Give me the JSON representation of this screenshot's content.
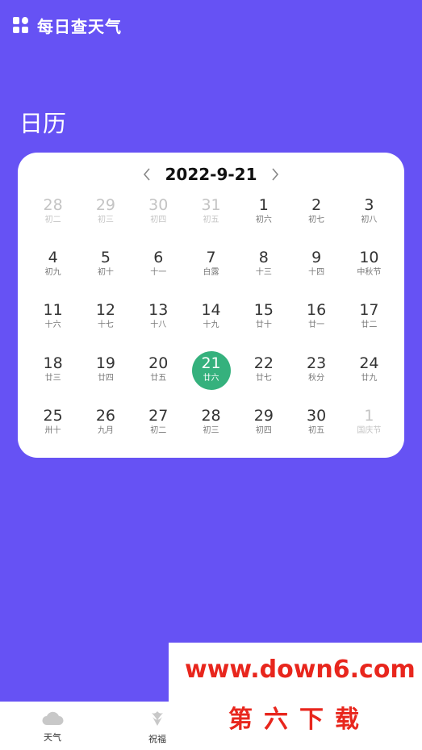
{
  "header": {
    "title": "每日查天气"
  },
  "page_title": "日历",
  "calendar": {
    "current_date": "2022-9-21",
    "days": [
      {
        "num": "28",
        "lunar": "初二",
        "muted": true
      },
      {
        "num": "29",
        "lunar": "初三",
        "muted": true
      },
      {
        "num": "30",
        "lunar": "初四",
        "muted": true
      },
      {
        "num": "31",
        "lunar": "初五",
        "muted": true
      },
      {
        "num": "1",
        "lunar": "初六"
      },
      {
        "num": "2",
        "lunar": "初七"
      },
      {
        "num": "3",
        "lunar": "初八"
      },
      {
        "num": "4",
        "lunar": "初九"
      },
      {
        "num": "5",
        "lunar": "初十"
      },
      {
        "num": "6",
        "lunar": "十一"
      },
      {
        "num": "7",
        "lunar": "白露"
      },
      {
        "num": "8",
        "lunar": "十三"
      },
      {
        "num": "9",
        "lunar": "十四"
      },
      {
        "num": "10",
        "lunar": "中秋节"
      },
      {
        "num": "11",
        "lunar": "十六"
      },
      {
        "num": "12",
        "lunar": "十七"
      },
      {
        "num": "13",
        "lunar": "十八"
      },
      {
        "num": "14",
        "lunar": "十九"
      },
      {
        "num": "15",
        "lunar": "廿十"
      },
      {
        "num": "16",
        "lunar": "廿一"
      },
      {
        "num": "17",
        "lunar": "廿二"
      },
      {
        "num": "18",
        "lunar": "廿三"
      },
      {
        "num": "19",
        "lunar": "廿四"
      },
      {
        "num": "20",
        "lunar": "廿五"
      },
      {
        "num": "21",
        "lunar": "廿六",
        "selected": true
      },
      {
        "num": "22",
        "lunar": "廿七"
      },
      {
        "num": "23",
        "lunar": "秋分"
      },
      {
        "num": "24",
        "lunar": "廿九"
      },
      {
        "num": "25",
        "lunar": "卅十"
      },
      {
        "num": "26",
        "lunar": "九月"
      },
      {
        "num": "27",
        "lunar": "初二"
      },
      {
        "num": "28",
        "lunar": "初三"
      },
      {
        "num": "29",
        "lunar": "初四"
      },
      {
        "num": "30",
        "lunar": "初五"
      },
      {
        "num": "1",
        "lunar": "国庆节",
        "muted": true
      }
    ]
  },
  "bottom_nav": {
    "items": [
      {
        "label": "天气",
        "icon": "cloud-icon"
      },
      {
        "label": "祝福",
        "icon": "flower-icon"
      }
    ]
  },
  "watermark": {
    "url": "www.down6.com",
    "name": "第六下载"
  },
  "colors": {
    "background": "#6652f4",
    "selected": "#35b17d",
    "watermark": "#e8261d"
  }
}
